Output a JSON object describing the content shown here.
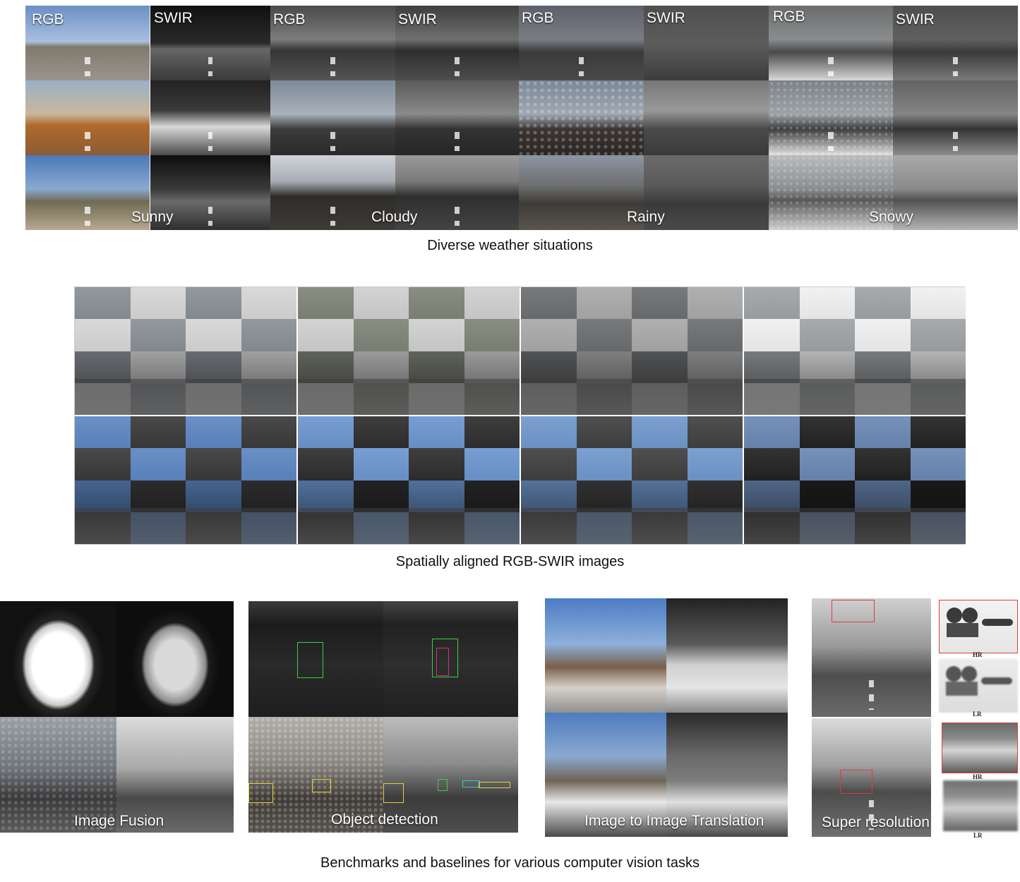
{
  "weather": {
    "caption": "Diverse weather situations",
    "groups": [
      {
        "rgb": "RGB",
        "swir": "SWIR",
        "condition": "Sunny"
      },
      {
        "rgb": "RGB",
        "swir": "SWIR",
        "condition": "Cloudy"
      },
      {
        "rgb": "RGB",
        "swir": "SWIR",
        "condition": "Rainy"
      },
      {
        "rgb": "RGB",
        "swir": "SWIR",
        "condition": "Snowy"
      }
    ]
  },
  "aligned": {
    "caption": "Spatially aligned RGB-SWIR images"
  },
  "tasks": {
    "caption": "Benchmarks and baselines for various computer vision tasks",
    "items": [
      "Image Fusion",
      "Object detection",
      "Image to Image Translation",
      "Super resolution"
    ],
    "sr_labels": [
      "HR",
      "LR",
      "HR",
      "LR"
    ]
  }
}
